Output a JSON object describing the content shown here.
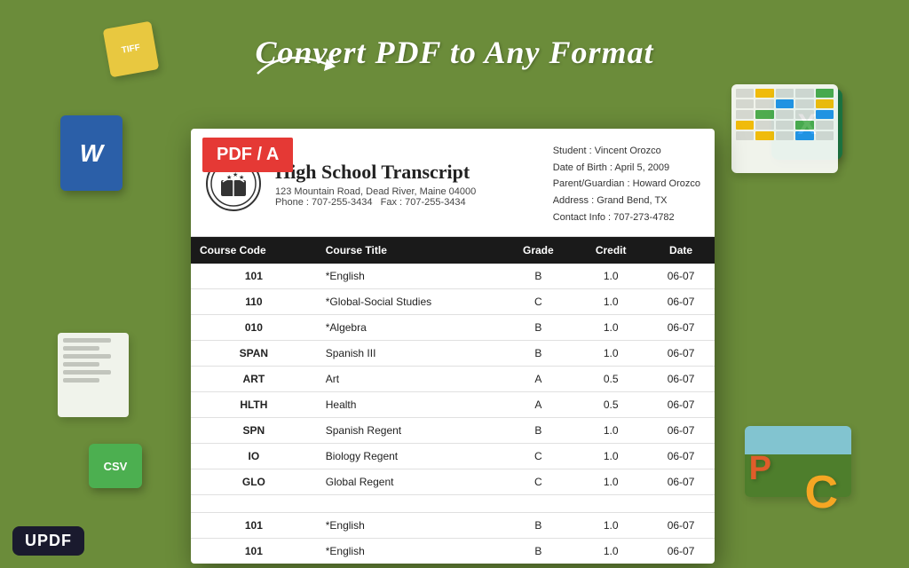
{
  "page": {
    "title": "Convert PDF to Any Format",
    "background_color": "#6b8c3a"
  },
  "header": {
    "title": "Convert PDF to Any Format"
  },
  "badges": {
    "pdf_a": "PDF / A",
    "csv": "CSV",
    "updf": "UPDF"
  },
  "document": {
    "title": "High School Transcript",
    "address": "123 Mountain Road, Dead River, Maine 04000",
    "phone": "Phone : 707-255-3434",
    "fax": "Fax : 707-255-3434",
    "student": "Student : Vincent Orozco",
    "dob": "Date of Birth : April 5,  2009",
    "parent": "Parent/Guardian : Howard Orozco",
    "address_info": "Address : Grand Bend, TX",
    "contact": "Contact Info : 707-273-4782"
  },
  "table": {
    "headers": [
      "Course Code",
      "Course Title",
      "Grade",
      "Credit",
      "Date"
    ],
    "rows": [
      {
        "code": "101",
        "title": "*English",
        "grade": "B",
        "credit": "1.0",
        "date": "06-07"
      },
      {
        "code": "110",
        "title": "*Global-Social Studies",
        "grade": "C",
        "credit": "1.0",
        "date": "06-07"
      },
      {
        "code": "010",
        "title": "*Algebra",
        "grade": "B",
        "credit": "1.0",
        "date": "06-07"
      },
      {
        "code": "SPAN",
        "title": "Spanish III",
        "grade": "B",
        "credit": "1.0",
        "date": "06-07"
      },
      {
        "code": "ART",
        "title": "Art",
        "grade": "A",
        "credit": "0.5",
        "date": "06-07"
      },
      {
        "code": "HLTH",
        "title": "Health",
        "grade": "A",
        "credit": "0.5",
        "date": "06-07"
      },
      {
        "code": "SPN",
        "title": "Spanish Regent",
        "grade": "B",
        "credit": "1.0",
        "date": "06-07"
      },
      {
        "code": "IO",
        "title": "Biology Regent",
        "grade": "C",
        "credit": "1.0",
        "date": "06-07"
      },
      {
        "code": "GLO",
        "title": "Global Regent",
        "grade": "C",
        "credit": "1.0",
        "date": "06-07"
      },
      {
        "code": "",
        "title": "",
        "grade": "",
        "credit": "",
        "date": ""
      },
      {
        "code": "101",
        "title": "*English",
        "grade": "B",
        "credit": "1.0",
        "date": "06-07"
      },
      {
        "code": "101",
        "title": "*English",
        "grade": "B",
        "credit": "1.0",
        "date": "06-07"
      }
    ]
  },
  "decorative": {
    "excel_label": "X",
    "word_label": "W",
    "csv_label": "CSV",
    "tiff_label": "TIFF"
  }
}
